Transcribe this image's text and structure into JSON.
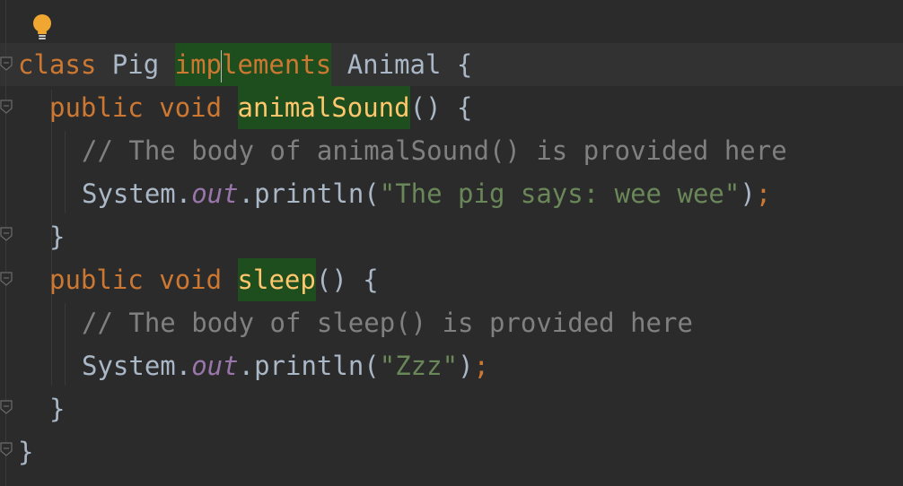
{
  "editor": {
    "language": "java",
    "colors": {
      "background": "#2b2b2b",
      "keyword": "#cc7832",
      "function": "#ffc66d",
      "comment": "#808080",
      "string": "#6a8759",
      "field": "#9876aa",
      "plain": "#a9b7c6",
      "highlight": "#1e4d1e"
    },
    "icons": {
      "intention": "lightbulb-icon",
      "fold": "fold-marker-icon"
    },
    "lines": [
      {
        "tokens": [
          {
            "t": "class",
            "k": "kw"
          },
          {
            "t": " Pig ",
            "k": "pl"
          },
          {
            "t": "imp",
            "k": "kw",
            "h": true
          },
          {
            "t": "lements",
            "k": "kw",
            "h": true
          },
          {
            "t": " Animal {",
            "k": "pl"
          }
        ]
      },
      {
        "tokens": [
          {
            "t": "public",
            "k": "kw"
          },
          {
            "t": " ",
            "k": "pl"
          },
          {
            "t": "void",
            "k": "kw"
          },
          {
            "t": " ",
            "k": "pl"
          },
          {
            "t": "animalSound",
            "k": "fn",
            "h": true
          },
          {
            "t": "() {",
            "k": "pl"
          }
        ]
      },
      {
        "tokens": [
          {
            "t": "// The body of animalSound() is provided here",
            "k": "cm"
          }
        ]
      },
      {
        "tokens": [
          {
            "t": "System.",
            "k": "pl"
          },
          {
            "t": "out",
            "k": "fld"
          },
          {
            "t": ".println(",
            "k": "pl"
          },
          {
            "t": "\"The pig says: wee wee\"",
            "k": "str"
          },
          {
            "t": ")",
            "k": "pl"
          },
          {
            "t": ";",
            "k": "kw"
          }
        ]
      },
      {
        "tokens": [
          {
            "t": "}",
            "k": "pl"
          }
        ]
      },
      {
        "tokens": [
          {
            "t": "public",
            "k": "kw"
          },
          {
            "t": " ",
            "k": "pl"
          },
          {
            "t": "void",
            "k": "kw"
          },
          {
            "t": " ",
            "k": "pl"
          },
          {
            "t": "sleep",
            "k": "fn",
            "h": true
          },
          {
            "t": "() {",
            "k": "pl"
          }
        ]
      },
      {
        "tokens": [
          {
            "t": "// The body of sleep() is provided here",
            "k": "cm"
          }
        ]
      },
      {
        "tokens": [
          {
            "t": "System.",
            "k": "pl"
          },
          {
            "t": "out",
            "k": "fld"
          },
          {
            "t": ".println(",
            "k": "pl"
          },
          {
            "t": "\"Zzz\"",
            "k": "str"
          },
          {
            "t": ")",
            "k": "pl"
          },
          {
            "t": ";",
            "k": "kw"
          }
        ]
      },
      {
        "tokens": [
          {
            "t": "}",
            "k": "pl"
          }
        ]
      },
      {
        "tokens": [
          {
            "t": "}",
            "k": "pl"
          }
        ]
      }
    ]
  }
}
